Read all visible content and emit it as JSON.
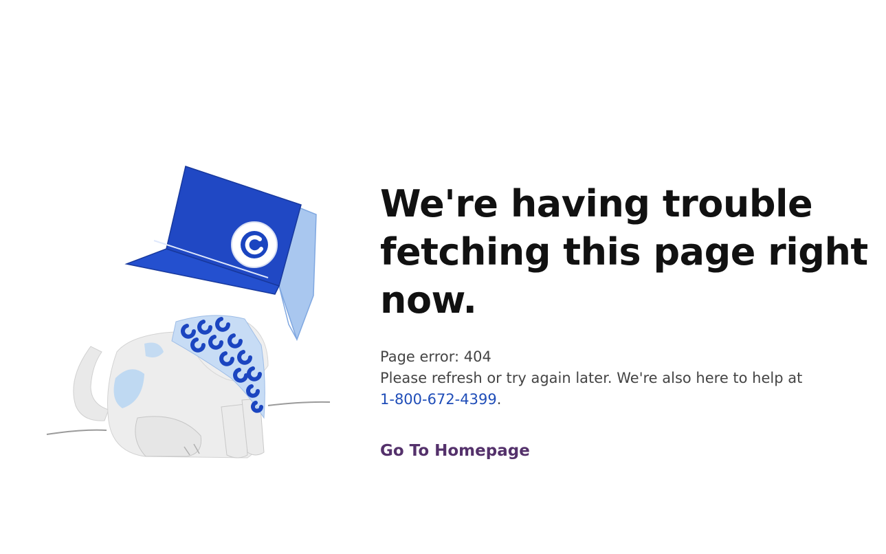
{
  "error_page": {
    "headline": "We're having trouble fetching this page right now.",
    "error_code_text": "Page error: 404",
    "help_text": "Please refresh or try again later. We're also here to help at",
    "phone_number": "1-800-672-4399",
    "phone_suffix": ".",
    "home_link_label": "Go To Homepage"
  },
  "illustration": {
    "icon": "dog-with-box-hat-illustration",
    "brand_mark": "c",
    "colors": {
      "box_blue": "#2048c4",
      "box_side": "#a9c7ef",
      "bandana_light": "#c7dcf5",
      "bandana_pattern": "#1b45c0",
      "dog_body": "#ededed",
      "dog_spot": "#b9d6f2"
    }
  },
  "colors": {
    "headline": "#111111",
    "body_text": "#444444",
    "phone_link": "#1f4db8",
    "home_link": "#54316b"
  }
}
